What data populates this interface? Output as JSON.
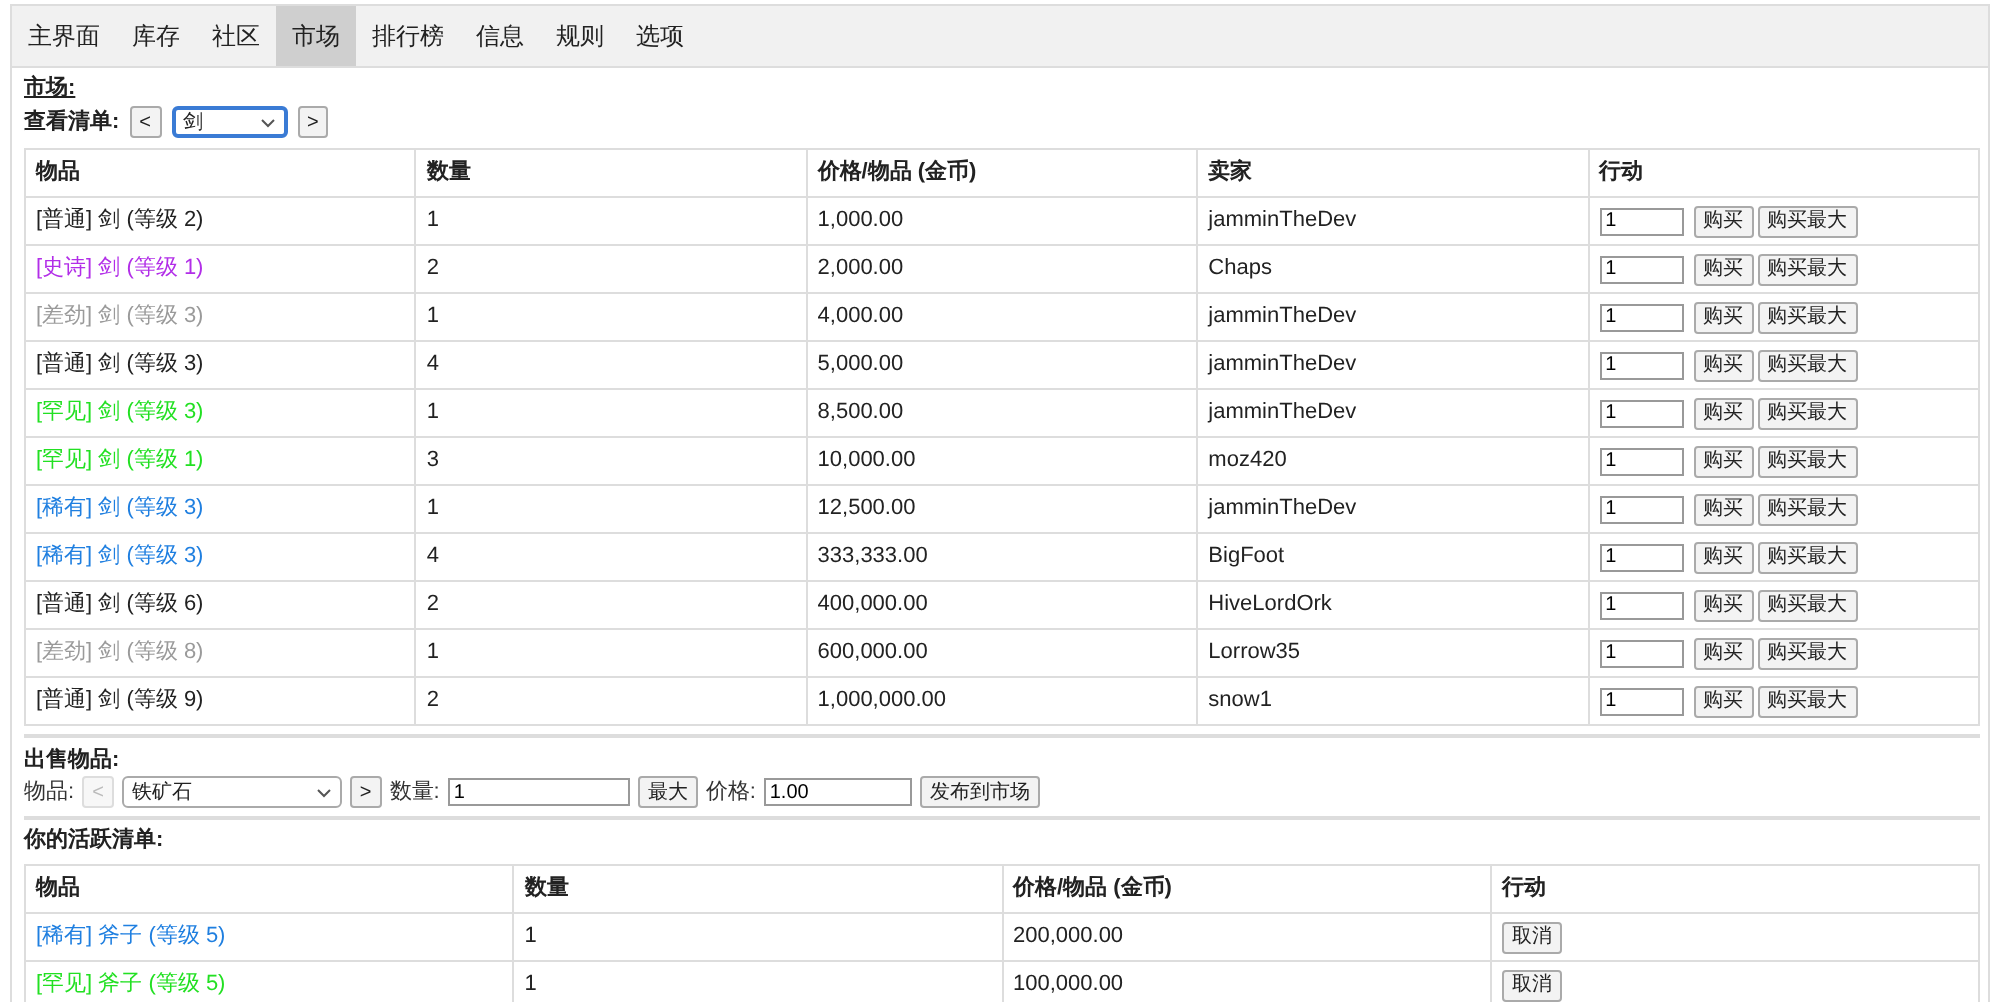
{
  "tabs": [
    {
      "label": "主界面",
      "selected": false
    },
    {
      "label": "库存",
      "selected": false
    },
    {
      "label": "社区",
      "selected": false
    },
    {
      "label": "市场",
      "selected": true
    },
    {
      "label": "排行榜",
      "selected": false
    },
    {
      "label": "信息",
      "selected": false
    },
    {
      "label": "规则",
      "selected": false
    },
    {
      "label": "选项",
      "selected": false
    }
  ],
  "market": {
    "title": "市场:",
    "view_label": "查看清单:",
    "prev_button": {
      "label": "<",
      "disabled": false
    },
    "filter_select": {
      "value": "剑"
    },
    "next_button": {
      "label": ">",
      "disabled": false
    },
    "columns": [
      "物品",
      "数量",
      "价格/物品 (金币)",
      "卖家",
      "行动"
    ],
    "rows": [
      {
        "item": "[普通] 剑 (等级 2)",
        "color": "#222222",
        "quantity": "1",
        "price": "1,000.00",
        "seller": "jamminTheDev",
        "amount": "1",
        "buy": "购买",
        "buy_max": "购买最大"
      },
      {
        "item": "[史诗] 剑 (等级 1)",
        "color": "#b22ee8",
        "quantity": "2",
        "price": "2,000.00",
        "seller": "Chaps",
        "amount": "1",
        "buy": "购买",
        "buy_max": "购买最大"
      },
      {
        "item": "[差劲] 剑 (等级 3)",
        "color": "#9a9a9a",
        "quantity": "1",
        "price": "4,000.00",
        "seller": "jamminTheDev",
        "amount": "1",
        "buy": "购买",
        "buy_max": "购买最大"
      },
      {
        "item": "[普通] 剑 (等级 3)",
        "color": "#222222",
        "quantity": "4",
        "price": "5,000.00",
        "seller": "jamminTheDev",
        "amount": "1",
        "buy": "购买",
        "buy_max": "购买最大"
      },
      {
        "item": "[罕见] 剑 (等级 3)",
        "color": "#22e022",
        "quantity": "1",
        "price": "8,500.00",
        "seller": "jamminTheDev",
        "amount": "1",
        "buy": "购买",
        "buy_max": "购买最大"
      },
      {
        "item": "[罕见] 剑 (等级 1)",
        "color": "#22e022",
        "quantity": "3",
        "price": "10,000.00",
        "seller": "moz420",
        "amount": "1",
        "buy": "购买",
        "buy_max": "购买最大"
      },
      {
        "item": "[稀有] 剑 (等级 3)",
        "color": "#1f7fe0",
        "quantity": "1",
        "price": "12,500.00",
        "seller": "jamminTheDev",
        "amount": "1",
        "buy": "购买",
        "buy_max": "购买最大"
      },
      {
        "item": "[稀有] 剑 (等级 3)",
        "color": "#1f7fe0",
        "quantity": "4",
        "price": "333,333.00",
        "seller": "BigFoot",
        "amount": "1",
        "buy": "购买",
        "buy_max": "购买最大"
      },
      {
        "item": "[普通] 剑 (等级 6)",
        "color": "#222222",
        "quantity": "2",
        "price": "400,000.00",
        "seller": "HiveLordOrk",
        "amount": "1",
        "buy": "购买",
        "buy_max": "购买最大"
      },
      {
        "item": "[差劲] 剑 (等级 8)",
        "color": "#9a9a9a",
        "quantity": "1",
        "price": "600,000.00",
        "seller": "Lorrow35",
        "amount": "1",
        "buy": "购买",
        "buy_max": "购买最大"
      },
      {
        "item": "[普通] 剑 (等级 9)",
        "color": "#222222",
        "quantity": "2",
        "price": "1,000,000.00",
        "seller": "snow1",
        "amount": "1",
        "buy": "购买",
        "buy_max": "购买最大"
      }
    ]
  },
  "sell": {
    "title": "出售物品:",
    "item_label": "物品:",
    "prev_button": {
      "label": "<",
      "disabled": true
    },
    "item_select": {
      "value": "铁矿石"
    },
    "next_button": {
      "label": ">",
      "disabled": false
    },
    "quantity_label": "数量:",
    "quantity": "1",
    "max_button": "最大",
    "price_label": "价格:",
    "price": "1.00",
    "post_button": "发布到市场"
  },
  "active": {
    "title": "你的活跃清单:",
    "columns": [
      "物品",
      "数量",
      "价格/物品 (金币)",
      "行动"
    ],
    "rows": [
      {
        "item": "[稀有] 斧子 (等级 5)",
        "color": "#1f7fe0",
        "quantity": "1",
        "price": "200,000.00",
        "cancel": "取消"
      },
      {
        "item": "[罕见] 斧子 (等级 5)",
        "color": "#22e022",
        "quantity": "1",
        "price": "100,000.00",
        "cancel": "取消"
      }
    ]
  }
}
